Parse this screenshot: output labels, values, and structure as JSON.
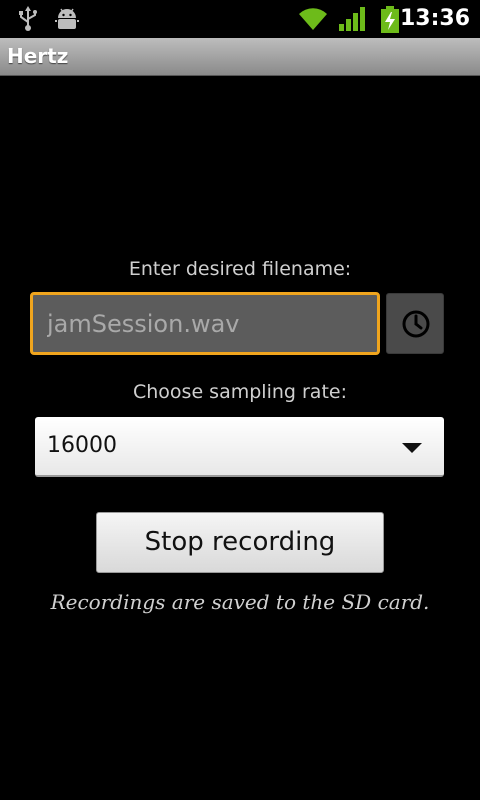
{
  "status_bar": {
    "time": "13:36",
    "icons": [
      "usb-icon",
      "android-debug-icon",
      "wifi-icon",
      "signal-icon",
      "battery-charging-icon"
    ]
  },
  "app": {
    "title": "Hertz"
  },
  "filename": {
    "label": "Enter desired filename:",
    "placeholder": "jamSession.wav",
    "value": ""
  },
  "timestamp_button": {
    "icon": "clock-icon"
  },
  "sampling": {
    "label": "Choose sampling rate:",
    "selected": "16000"
  },
  "record_button": {
    "label": "Stop recording"
  },
  "note": "Recordings are saved to the SD card.",
  "colors": {
    "background": "#000000",
    "focus_border": "#f0a51e",
    "title_bar": "#a0a0a0"
  }
}
